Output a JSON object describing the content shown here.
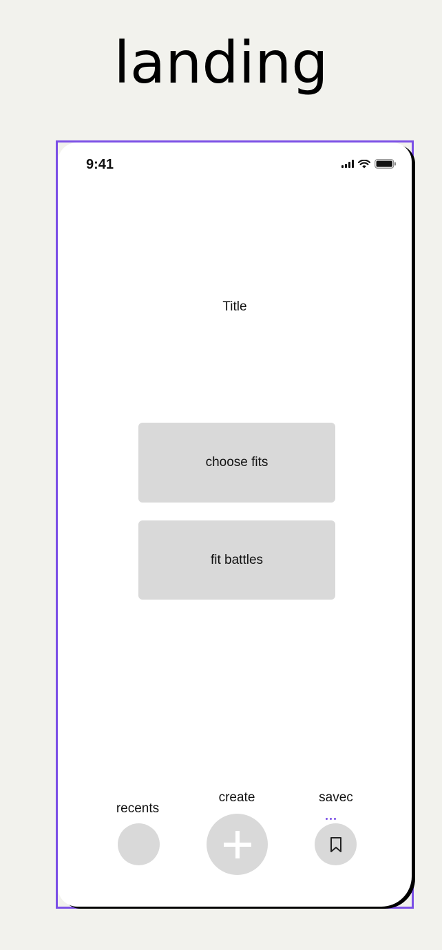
{
  "page": {
    "heading": "landing"
  },
  "status_bar": {
    "time": "9:41",
    "icons": [
      "cellular-signal-icon",
      "wifi-icon",
      "battery-icon"
    ]
  },
  "screen": {
    "title": "Title"
  },
  "buttons": {
    "choose_fits": "choose fits",
    "fit_battles": "fit battles"
  },
  "bottom_nav": {
    "recents_label": "recents",
    "create_label": "create",
    "saved_label": "savec",
    "create_icon": "plus-icon",
    "saved_icon": "bookmark-icon"
  },
  "colors": {
    "background": "#f2f2ed",
    "frame_border": "#7b4fe6",
    "button_fill": "#d9d9d9"
  }
}
